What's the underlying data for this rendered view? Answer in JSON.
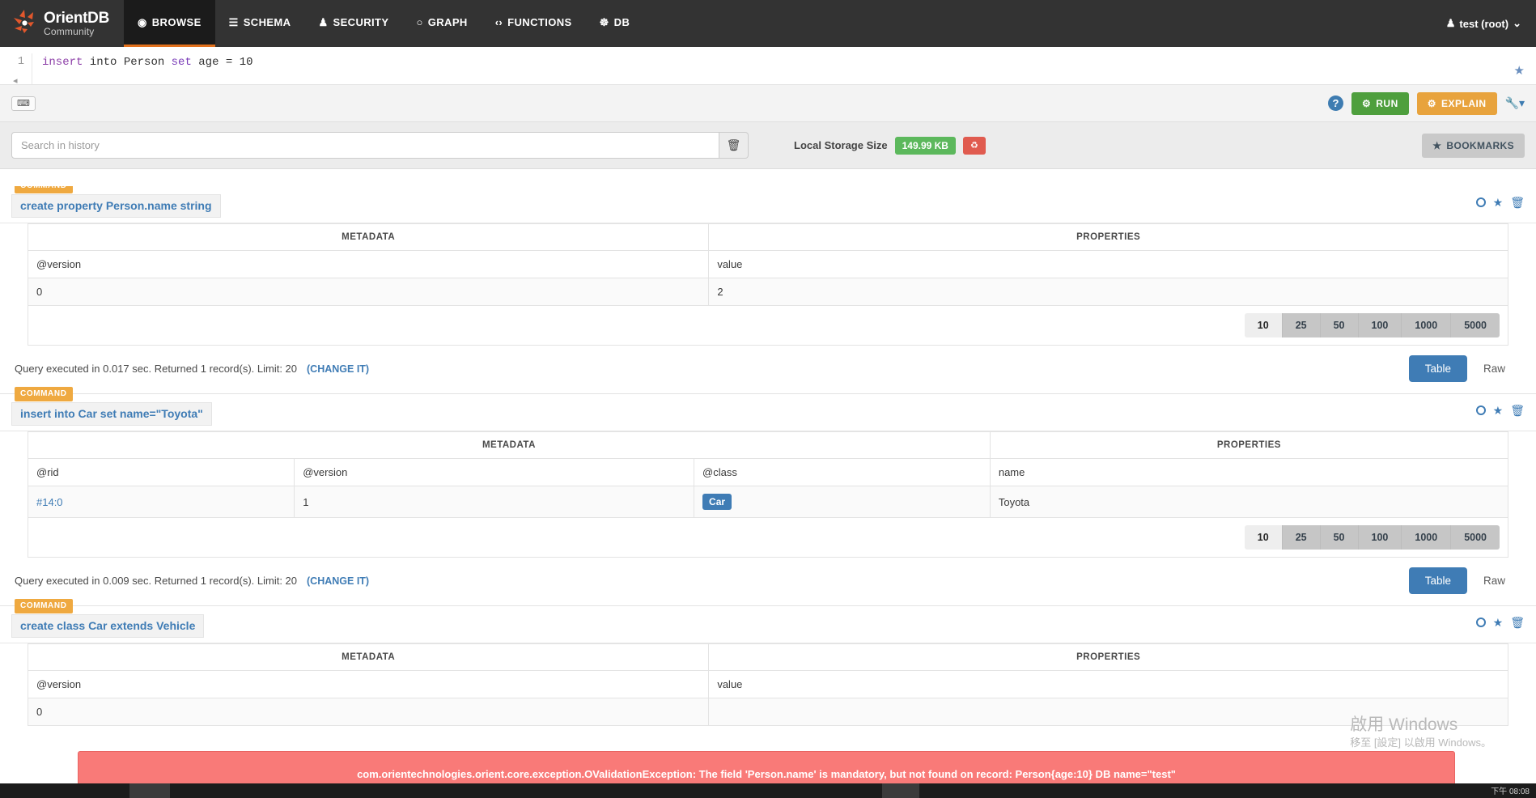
{
  "navbar": {
    "brand_primary": "Orient",
    "brand_accent": "DB",
    "brand_sub": "Community",
    "items": [
      {
        "label": "BROWSE",
        "icon": "eye-icon",
        "glyph": "◉",
        "active": true
      },
      {
        "label": "SCHEMA",
        "icon": "list-icon",
        "glyph": "☰",
        "active": false
      },
      {
        "label": "SECURITY",
        "icon": "user-lock-icon",
        "glyph": "♟",
        "active": false
      },
      {
        "label": "GRAPH",
        "icon": "circle-node-icon",
        "glyph": "○",
        "active": false
      },
      {
        "label": "FUNCTIONS",
        "icon": "code-icon",
        "glyph": "‹›",
        "active": false
      },
      {
        "label": "DB",
        "icon": "database-icon",
        "glyph": "⌸",
        "active": false
      }
    ],
    "user": "test (root)",
    "user_icon": "user-icon",
    "caret": "⌄"
  },
  "editor": {
    "line_number": "1",
    "query_tokens": [
      {
        "t": "insert",
        "cls": "kw"
      },
      {
        "t": " into ",
        "cls": ""
      },
      {
        "t": "Person ",
        "cls": ""
      },
      {
        "t": "set",
        "cls": "kw2"
      },
      {
        "t": " age = ",
        "cls": ""
      },
      {
        "t": "10",
        "cls": "num"
      }
    ],
    "query_plain": "insert into Person set age = 10",
    "star_icon": "star-icon",
    "keyboard_button": "⌨",
    "help_label": "?",
    "run_label": "RUN",
    "explain_label": "EXPLAIN",
    "run_icon": "gear-icon",
    "explain_icon": "gears-icon",
    "wrench_icon": "wrench-dropdown-icon",
    "collapse_icon": "collapse-arrow-icon"
  },
  "history": {
    "search_placeholder": "Search in history",
    "search_value": "",
    "trash_icon": "trash-icon",
    "storage_label": "Local Storage Size",
    "storage_value": "149.99 KB",
    "recycle_icon": "recycle-icon",
    "bookmarks_label": "BOOKMARKS",
    "bookmarks_icon": "star-icon"
  },
  "cards": [
    {
      "badge": "COMMAND",
      "query": "create property Person.name string",
      "icons": {
        "reload": "circle-reload-icon",
        "bookmark": "star-icon",
        "delete": "trash-icon"
      },
      "group_headers": [
        {
          "label": "METADATA",
          "span": 1
        },
        {
          "label": "PROPERTIES",
          "span": 1
        }
      ],
      "columns": [
        "@version",
        "value"
      ],
      "rows": [
        [
          "0",
          "2"
        ]
      ],
      "pager": [
        "10",
        "25",
        "50",
        "100",
        "1000",
        "5000"
      ],
      "pager_active": "10",
      "exec_text": "Query executed in 0.017 sec. Returned 1 record(s). Limit: 20",
      "change_it": "(CHANGE IT)",
      "view_tabs": [
        "Table",
        "Raw"
      ],
      "view_active": "Table"
    },
    {
      "badge": "COMMAND",
      "query": "insert into Car set name=\"Toyota\"",
      "icons": {
        "reload": "circle-reload-icon",
        "bookmark": "star-icon",
        "delete": "trash-icon"
      },
      "group_headers": [
        {
          "label": "METADATA",
          "span": 3
        },
        {
          "label": "PROPERTIES",
          "span": 1
        }
      ],
      "columns": [
        "@rid",
        "@version",
        "@class",
        "name"
      ],
      "rows": [
        [
          "#14:0",
          "1",
          "Car",
          "Toyota"
        ]
      ],
      "pager": [
        "10",
        "25",
        "50",
        "100",
        "1000",
        "5000"
      ],
      "pager_active": "10",
      "exec_text": "Query executed in 0.009 sec. Returned 1 record(s). Limit: 20",
      "change_it": "(CHANGE IT)",
      "view_tabs": [
        "Table",
        "Raw"
      ],
      "view_active": "Table"
    },
    {
      "badge": "COMMAND",
      "query": "create class Car extends Vehicle",
      "icons": {
        "reload": "circle-reload-icon",
        "bookmark": "star-icon",
        "delete": "trash-icon"
      },
      "group_headers": [
        {
          "label": "METADATA",
          "span": 1
        },
        {
          "label": "PROPERTIES",
          "span": 1
        }
      ],
      "columns": [
        "@version",
        "value"
      ],
      "rows": [
        [
          "0",
          ""
        ]
      ]
    }
  ],
  "error": {
    "message": "com.orientechnologies.orient.core.exception.OValidationException: The field 'Person.name' is mandatory, but not found on record: Person{age:10} DB name=\"test\""
  },
  "watermark": {
    "line1": "啟用 Windows",
    "line2": "移至 [設定] 以啟用 Windows。"
  },
  "osbar": {
    "clock": "下午 08:08"
  },
  "colors": {
    "nav_bg": "#333333",
    "accent_orange": "#e2711d",
    "run_green": "#4e9f3d",
    "explain_orange": "#e8a33d",
    "link_blue": "#3f7cb5",
    "badge_green": "#5cb85c",
    "error_red": "#f97a78",
    "command_badge": "#efa940"
  }
}
